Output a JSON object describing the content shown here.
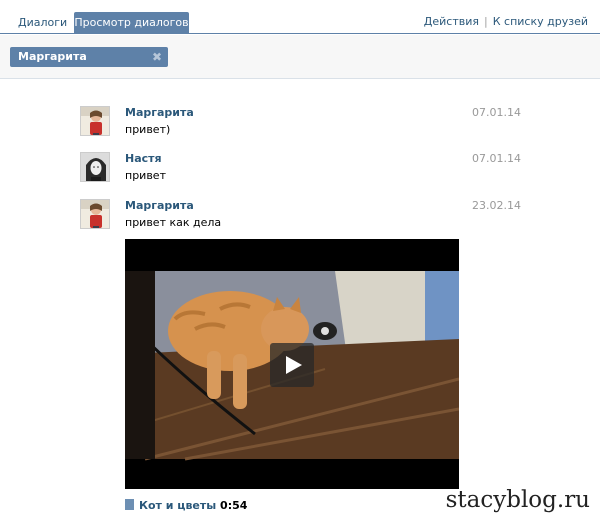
{
  "tabs": {
    "dialogs": "Диалоги",
    "view_dialogs": "Просмотр диалогов"
  },
  "actions": {
    "actions_label": "Действия",
    "separator": "|",
    "friends_list": "К списку друзей"
  },
  "filter": {
    "chip_label": "Маргарита",
    "close_glyph": "✖"
  },
  "messages": [
    {
      "author": "Маргарита",
      "date": "07.01.14",
      "text": "привет)"
    },
    {
      "author": "Настя",
      "date": "07.01.14",
      "text": "привет"
    },
    {
      "author": "Маргарита",
      "date": "23.02.14",
      "text": "привет как дела"
    }
  ],
  "video": {
    "title": "Кот и цветы",
    "duration": "0:54"
  },
  "watermark": "stacyblog.ru",
  "colors": {
    "accent": "#5e81a8",
    "link": "#2b587a",
    "date": "#999999"
  }
}
